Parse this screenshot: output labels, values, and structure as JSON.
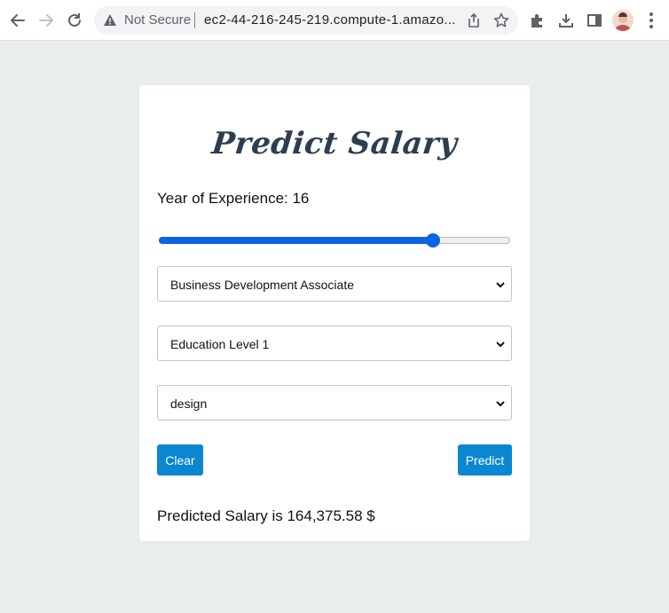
{
  "browser": {
    "security_label": "Not Secure",
    "url": "ec2-44-216-245-219.compute-1.amazo..."
  },
  "app": {
    "title": "Predict Salary",
    "experience": {
      "label_prefix": "Year of Experience: ",
      "value": "16",
      "slider_fraction": 0.78
    },
    "job_title_select": {
      "selected": "Business Development Associate"
    },
    "education_select": {
      "selected": "Education Level 1"
    },
    "field_select": {
      "selected": "design"
    },
    "clear_label": "Clear",
    "predict_label": "Predict",
    "result_text": "Predicted Salary is 164,375.58 $"
  },
  "colors": {
    "accent": "#0b86d1",
    "slider": "#0a64e6",
    "title": "#2c3e50",
    "page_bg": "#e9eded"
  }
}
